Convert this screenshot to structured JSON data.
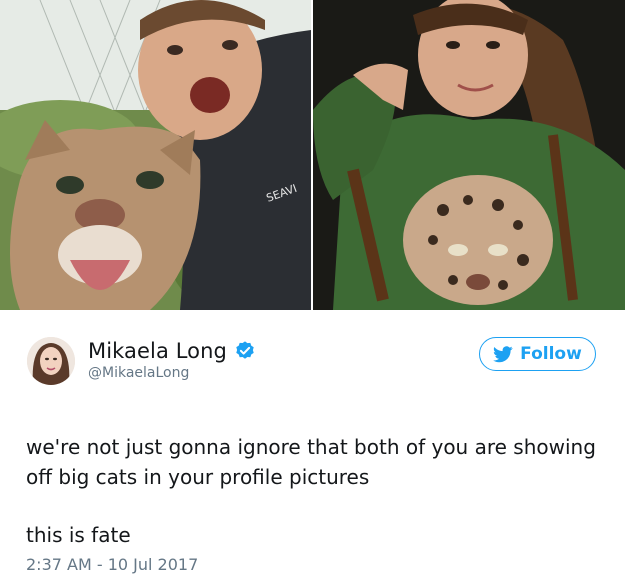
{
  "tweet": {
    "author": {
      "display_name": "Mikaela Long",
      "handle": "@MikaelaLong",
      "verified": true,
      "avatar_icon": "avatar-photo"
    },
    "follow_button": {
      "label": "Follow",
      "icon": "twitter-bird-icon"
    },
    "text_paragraphs": [
      "we're not just gonna ignore that both of you are showing off big cats in your profile pictures",
      "this is fate"
    ],
    "timestamp": "2:37 AM - 10 Jul 2017"
  },
  "photos": {
    "left": {
      "shirt_print": "SEAVI"
    },
    "right": {}
  },
  "colors": {
    "twitter_blue": "#1da1f2",
    "text_primary": "#14171a",
    "text_secondary": "#657786"
  }
}
